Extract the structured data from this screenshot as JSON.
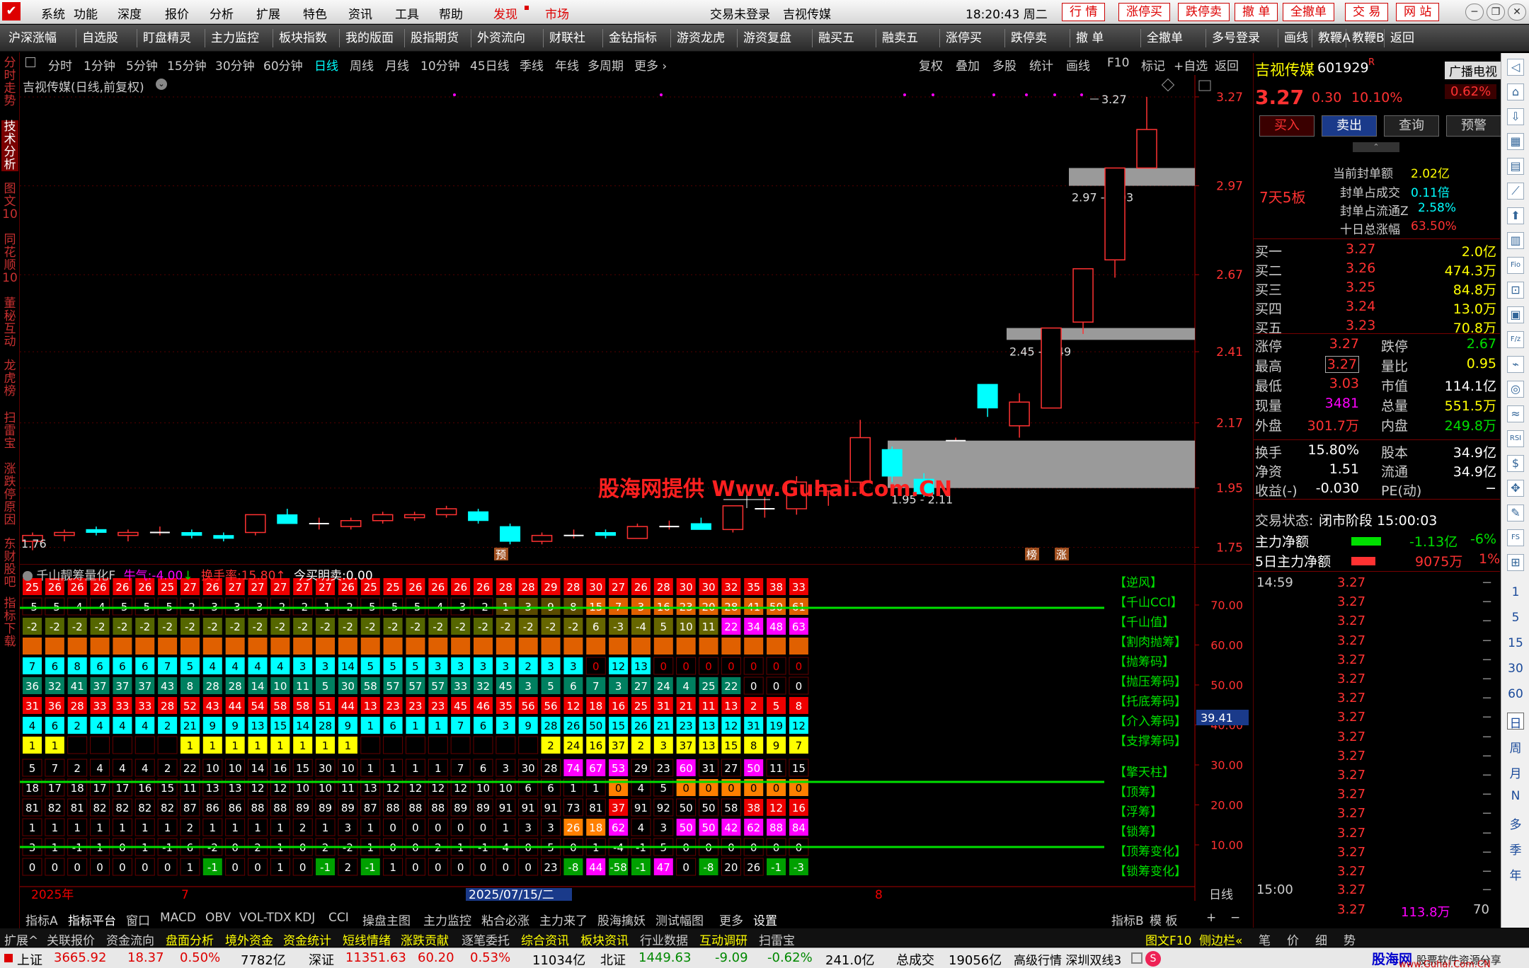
{
  "menu": {
    "items": [
      "系统",
      "功能",
      "深度",
      "报价",
      "分析",
      "扩展",
      "特色",
      "资讯",
      "工具",
      "帮助"
    ],
    "discover": "发现",
    "market": "市场",
    "login_status": "交易未登录",
    "window_stock": "吉视传媒",
    "clock": "18:20:43 周二",
    "quick": [
      "行 情",
      "涨停买",
      "跌停卖",
      "撤 单",
      "全撤单",
      "交 易",
      "网 站"
    ]
  },
  "toolbar": {
    "items": [
      "沪深涨幅",
      "自选股",
      "盯盘精灵",
      "主力监控",
      "板块指数",
      "我的版面",
      "股指期货",
      "外资流向",
      "财联社",
      "金钻指标",
      "游资龙虎",
      "游资复盘",
      "融买五",
      "融卖五",
      "涨停买",
      "跌停卖",
      "撤 单",
      "全撤单",
      "多号登录",
      "画线",
      "教鞭A",
      "教鞭B",
      "返回"
    ]
  },
  "leftnav": {
    "items": [
      "分时走势",
      "技术分析",
      "图文10",
      "同花顺10",
      "董秘互动",
      "龙虎榜",
      "扫雷宝",
      "涨跌停原因",
      "东财股吧",
      "指标下载"
    ]
  },
  "period": {
    "items": [
      "分时",
      "1分钟",
      "5分钟",
      "15分钟",
      "30分钟",
      "60分钟",
      "日线",
      "周线",
      "月线",
      "10分钟",
      "45日线",
      "季线",
      "年线",
      "多周期",
      "更多 ›"
    ],
    "active": "日线",
    "tools": [
      "复权",
      "叠加",
      "多股",
      "统计",
      "画线",
      "F10",
      "标记",
      "+自选",
      "返回"
    ]
  },
  "chart_title": "吉视传媒(日线,前复权)",
  "chart_data": {
    "type": "candlestick",
    "ylim": [
      1.72,
      3.32
    ],
    "yticks": [
      "3.27",
      "2.97",
      "2.67",
      "2.41",
      "2.17",
      "1.95",
      "1.75"
    ],
    "candles": [
      {
        "o": 1.77,
        "h": 1.8,
        "l": 1.74,
        "c": 1.79
      },
      {
        "o": 1.79,
        "h": 1.81,
        "l": 1.77,
        "c": 1.8
      },
      {
        "o": 1.81,
        "h": 1.82,
        "l": 1.79,
        "c": 1.8
      },
      {
        "o": 1.79,
        "h": 1.81,
        "l": 1.77,
        "c": 1.8
      },
      {
        "o": 1.8,
        "h": 1.82,
        "l": 1.79,
        "c": 1.8
      },
      {
        "o": 1.8,
        "h": 1.81,
        "l": 1.78,
        "c": 1.79
      },
      {
        "o": 1.79,
        "h": 1.8,
        "l": 1.77,
        "c": 1.78
      },
      {
        "o": 1.8,
        "h": 1.86,
        "l": 1.79,
        "c": 1.86
      },
      {
        "o": 1.86,
        "h": 1.88,
        "l": 1.83,
        "c": 1.83
      },
      {
        "o": 1.83,
        "h": 1.85,
        "l": 1.81,
        "c": 1.83
      },
      {
        "o": 1.82,
        "h": 1.85,
        "l": 1.81,
        "c": 1.84
      },
      {
        "o": 1.84,
        "h": 1.87,
        "l": 1.83,
        "c": 1.86
      },
      {
        "o": 1.85,
        "h": 1.87,
        "l": 1.84,
        "c": 1.86
      },
      {
        "o": 1.86,
        "h": 1.89,
        "l": 1.85,
        "c": 1.88
      },
      {
        "o": 1.87,
        "h": 1.88,
        "l": 1.83,
        "c": 1.84
      },
      {
        "o": 1.82,
        "h": 1.83,
        "l": 1.76,
        "c": 1.77
      },
      {
        "o": 1.77,
        "h": 1.8,
        "l": 1.76,
        "c": 1.79
      },
      {
        "o": 1.79,
        "h": 1.81,
        "l": 1.78,
        "c": 1.79
      },
      {
        "o": 1.8,
        "h": 1.81,
        "l": 1.78,
        "c": 1.79
      },
      {
        "o": 1.78,
        "h": 1.83,
        "l": 1.78,
        "c": 1.82
      },
      {
        "o": 1.82,
        "h": 1.84,
        "l": 1.81,
        "c": 1.82
      },
      {
        "o": 1.83,
        "h": 1.85,
        "l": 1.81,
        "c": 1.81
      },
      {
        "o": 1.81,
        "h": 1.89,
        "l": 1.8,
        "c": 1.89
      },
      {
        "o": 1.88,
        "h": 1.92,
        "l": 1.85,
        "c": 1.88
      },
      {
        "o": 1.88,
        "h": 1.99,
        "l": 1.86,
        "c": 1.97
      },
      {
        "o": 1.94,
        "h": 1.96,
        "l": 1.89,
        "c": 1.96
      },
      {
        "o": 1.97,
        "h": 2.18,
        "l": 1.93,
        "c": 2.12
      },
      {
        "o": 2.08,
        "h": 2.09,
        "l": 1.97,
        "c": 1.99
      },
      {
        "o": 1.98,
        "h": 2.0,
        "l": 1.92,
        "c": 1.93
      },
      {
        "o": 2.11,
        "h": 2.12,
        "l": 2.11,
        "c": 2.11
      },
      {
        "o": 2.3,
        "h": 2.3,
        "l": 2.19,
        "c": 2.22
      },
      {
        "o": 2.16,
        "h": 2.27,
        "l": 2.12,
        "c": 2.24
      },
      {
        "o": 2.22,
        "h": 2.49,
        "l": 2.22,
        "c": 2.49
      },
      {
        "o": 2.51,
        "h": 2.69,
        "l": 2.47,
        "c": 2.69
      },
      {
        "o": 2.72,
        "h": 3.03,
        "l": 2.66,
        "c": 3.03
      },
      {
        "o": 3.03,
        "h": 3.27,
        "l": 3.03,
        "c": 3.16
      }
    ],
    "zones": [
      {
        "label": "2.97 - 3.03",
        "low": 2.97,
        "high": 3.03
      },
      {
        "label": "2.45 - 2.49",
        "low": 2.45,
        "high": 2.49
      },
      {
        "label": "1.95 - 2.11",
        "low": 1.95,
        "high": 2.11
      }
    ],
    "annotations": {
      "high": "3.27",
      "low": "1.76",
      "yu": "预",
      "bang": "榜",
      "zhang": "涨",
      "watermark": "股海网提供 Www.Guhai.Com.CN"
    }
  },
  "indicator": {
    "name": "千山靓筹量化F",
    "niuqi_label": "牛气:",
    "niuqi_value": "-4.00",
    "huanshou_label": "换手率:",
    "huanshou_value": "15.80",
    "jin_label": "今买明卖:",
    "jin_value": "0.00",
    "yticks": [
      "70.00",
      "60.00",
      "50.00",
      "40.00",
      "30.00",
      "20.00",
      "10.00"
    ],
    "cursor_value": "39.41",
    "row_labels": [
      "【逆风】",
      "【千山CCI】",
      "【千山值】",
      "【割肉抛筹】",
      "【抛筹码】",
      "【抛压筹码】",
      "【托底筹码】",
      "【介入筹码】",
      "【支撑筹码】",
      "【擎天柱】",
      "【顶筹】",
      "【浮筹】",
      "【锁筹】",
      "【顶筹变化】",
      "【锁筹变化】"
    ],
    "grid": [
      [
        "25",
        "26",
        "26",
        "26",
        "26",
        "26",
        "25",
        "27",
        "26",
        "27",
        "27",
        "27",
        "27",
        "27",
        "26",
        "25",
        "25",
        "26",
        "26",
        "26",
        "26",
        "28",
        "28",
        "29",
        "28",
        "30",
        "27",
        "26",
        "28",
        "30",
        "30",
        "32",
        "35",
        "38",
        "33"
      ],
      [
        "-5",
        "-5",
        "-4",
        "-4",
        "-5",
        "-5",
        "-5",
        "-2",
        "-3",
        "-3",
        "-3",
        "-2",
        "-2",
        "-1",
        "-2",
        "-5",
        "-5",
        "-5",
        "-4",
        "-3",
        "-2",
        "1",
        "3",
        "9",
        "8",
        "15",
        "7",
        "3",
        "16",
        "23",
        "20",
        "28",
        "41",
        "50",
        "61"
      ],
      [
        "-2",
        "-2",
        "-2",
        "-2",
        "-2",
        "-2",
        "-2",
        "-2",
        "-2",
        "-2",
        "-2",
        "-2",
        "-2",
        "-2",
        "-2",
        "-2",
        "-2",
        "-2",
        "-2",
        "-2",
        "-2",
        "-2",
        "-2",
        "-2",
        "-2",
        "6",
        "-3",
        "-4",
        "5",
        "10",
        "11",
        "22",
        "34",
        "48",
        "63"
      ],
      [
        "",
        "",
        "",
        "",
        "",
        "",
        "",
        "",
        "",
        "",
        "",
        "",
        "",
        "",
        "",
        "",
        "",
        "",
        "",
        "",
        "",
        "",
        "",
        "",
        "",
        "0",
        "0",
        "0",
        "0",
        "0",
        "0",
        "0",
        "0",
        "0",
        "0"
      ],
      [
        "7",
        "6",
        "8",
        "6",
        "6",
        "6",
        "7",
        "5",
        "4",
        "4",
        "4",
        "4",
        "3",
        "3",
        "14",
        "5",
        "5",
        "5",
        "3",
        "3",
        "3",
        "3",
        "2",
        "3",
        "3",
        "0",
        "12",
        "13",
        "0",
        "0",
        "0",
        "0",
        "0",
        "0",
        "0"
      ],
      [
        "36",
        "32",
        "41",
        "37",
        "37",
        "37",
        "43",
        "8",
        "28",
        "28",
        "14",
        "10",
        "11",
        "5",
        "30",
        "58",
        "57",
        "57",
        "57",
        "33",
        "32",
        "45",
        "3",
        "5",
        "6",
        "7",
        "3",
        "27",
        "24",
        "4",
        "25",
        "22",
        "0",
        "0",
        "0"
      ],
      [
        "31",
        "36",
        "28",
        "33",
        "33",
        "33",
        "28",
        "52",
        "43",
        "44",
        "54",
        "58",
        "58",
        "51",
        "44",
        "13",
        "23",
        "23",
        "23",
        "45",
        "46",
        "35",
        "56",
        "56",
        "12",
        "18",
        "16",
        "25",
        "31",
        "21",
        "11",
        "13",
        "2",
        "5",
        "8"
      ],
      [
        "4",
        "6",
        "2",
        "4",
        "4",
        "4",
        "2",
        "21",
        "9",
        "9",
        "13",
        "15",
        "14",
        "28",
        "9",
        "1",
        "6",
        "1",
        "1",
        "7",
        "6",
        "3",
        "9",
        "28",
        "26",
        "50",
        "15",
        "26",
        "21",
        "23",
        "13",
        "12",
        "31",
        "19",
        "12"
      ],
      [
        "1",
        "1",
        "",
        "",
        "",
        "",
        "",
        "1",
        "1",
        "1",
        "1",
        "1",
        "1",
        "1",
        "1",
        "",
        "",
        "",
        "",
        "",
        "",
        "",
        "",
        "2",
        "24",
        "16",
        "37",
        "2",
        "3",
        "37",
        "13",
        "15",
        "8",
        "9",
        "7"
      ],
      [
        "5",
        "7",
        "2",
        "4",
        "4",
        "4",
        "2",
        "22",
        "10",
        "10",
        "14",
        "16",
        "15",
        "30",
        "10",
        "1",
        "1",
        "1",
        "1",
        "7",
        "6",
        "3",
        "30",
        "28",
        "74",
        "67",
        "53",
        "29",
        "23",
        "60",
        "31",
        "27",
        "50",
        "11",
        "15"
      ],
      [
        "18",
        "17",
        "18",
        "17",
        "17",
        "16",
        "15",
        "11",
        "13",
        "13",
        "12",
        "12",
        "10",
        "10",
        "11",
        "13",
        "12",
        "12",
        "12",
        "12",
        "10",
        "10",
        "6",
        "6",
        "1",
        "1",
        "0",
        "4",
        "5",
        "0",
        "0",
        "0",
        "0",
        "0",
        "0"
      ],
      [
        "81",
        "82",
        "81",
        "82",
        "82",
        "82",
        "82",
        "87",
        "86",
        "86",
        "88",
        "88",
        "89",
        "89",
        "89",
        "87",
        "88",
        "88",
        "88",
        "89",
        "89",
        "91",
        "91",
        "91",
        "73",
        "81",
        "37",
        "91",
        "92",
        "50",
        "50",
        "58",
        "38",
        "12",
        "16"
      ],
      [
        "1",
        "1",
        "1",
        "1",
        "1",
        "1",
        "1",
        "2",
        "1",
        "1",
        "1",
        "1",
        "2",
        "1",
        "3",
        "1",
        "0",
        "0",
        "0",
        "0",
        "0",
        "1",
        "3",
        "3",
        "26",
        "18",
        "62",
        "4",
        "3",
        "50",
        "50",
        "42",
        "62",
        "88",
        "84"
      ],
      [
        "3",
        "1",
        "-1",
        "1",
        "0",
        "1",
        "-1",
        "6",
        "-2",
        "0",
        "2",
        "1",
        "0",
        "2",
        "-2",
        "1",
        "0",
        "0",
        "2",
        "1",
        "-1",
        "4",
        "0",
        "5",
        "0",
        "1",
        "-4",
        "-1",
        "5",
        "0",
        "0",
        "0",
        "0",
        "0",
        "0"
      ],
      [
        "0",
        "0",
        "0",
        "0",
        "0",
        "0",
        "0",
        "1",
        "-1",
        "0",
        "0",
        "1",
        "0",
        "-1",
        "2",
        "-1",
        "1",
        "0",
        "0",
        "0",
        "0",
        "0",
        "0",
        "23",
        "-8",
        "44",
        "-58",
        "-1",
        "47",
        "0",
        "-8",
        "20",
        "26",
        "-1",
        "-3"
      ]
    ],
    "date_labels": [
      "2025年",
      "7",
      "2025/07/15/二",
      "8"
    ],
    "period_label": "日线"
  },
  "bottom_tabs": {
    "items": [
      "指标A",
      "指标平台",
      "窗口",
      "MACD",
      "OBV",
      "VOL-TDX",
      "KDJ",
      "CCI",
      "操盘主图",
      "主力监控",
      "粘合必涨",
      "主力来了",
      "股海擒妖",
      "测试幅图",
      "更多",
      "设置"
    ],
    "right": [
      "指标B",
      "模 板",
      "+",
      "−"
    ]
  },
  "bottom_tabs2": {
    "items": [
      "扩展^",
      "关联报价",
      "资金流向",
      "盘面分析",
      "境外资金",
      "资金统计",
      "短线情绪",
      "涨跌贡献",
      "逐笔委托",
      "综合资讯",
      "板块资讯",
      "行业数据",
      "互动调研",
      "扫雷宝"
    ],
    "right": [
      "图文F10",
      "侧边栏«",
      "笔",
      "价",
      "细",
      "势"
    ]
  },
  "status": {
    "sh_label": "上证",
    "sh_val": "3665.92",
    "sh_chg": "18.37",
    "sh_pct": "0.50%",
    "sh_amt": "7782亿",
    "sz_label": "深证",
    "sz_val": "11351.63",
    "sz_chg": "60.20",
    "sz_pct": "0.53%",
    "sz_amt": "11034亿",
    "bz_label": "北证",
    "bz_val": "1449.63",
    "bz_chg": "-9.09",
    "bz_pct": "-0.62%",
    "bz_amt": "241.0亿",
    "total_label": "总成交",
    "total_val": "19056亿",
    "mode": "高级行情 深圳双线3",
    "brand": "股海网",
    "brand_sub": "股票软件资源分享",
    "brand_url": "www.Guhai.Com.CN"
  },
  "quote": {
    "name": "吉视传媒",
    "code": "601929",
    "r": "R",
    "broadcast": "广播电视",
    "sector_pct": "0.62%",
    "price": "3.27",
    "change": "0.30",
    "pct": "10.10%",
    "buttons": [
      "买入",
      "卖出",
      "查询",
      "预警"
    ],
    "streak": "7天5板",
    "seal_label": "当前封单额",
    "seal_val": "2.02亿",
    "seal_turn_label": "封单占成交",
    "seal_turn_val": "0.11倍",
    "seal_float_label": "封单占流通Z",
    "seal_float_val": "2.58%",
    "ten_day_label": "十日总涨幅",
    "ten_day_val": "63.50%",
    "bids": [
      [
        "买一",
        "3.27",
        "2.0亿"
      ],
      [
        "买二",
        "3.26",
        "474.3万"
      ],
      [
        "买三",
        "3.25",
        "84.8万"
      ],
      [
        "买四",
        "3.24",
        "13.0万"
      ],
      [
        "买五",
        "3.23",
        "70.8万"
      ]
    ],
    "stats": [
      [
        "涨停",
        "3.27",
        "跌停",
        "2.67"
      ],
      [
        "最高",
        "3.27",
        "量比",
        "0.95"
      ],
      [
        "最低",
        "3.03",
        "市值",
        "114.1亿"
      ],
      [
        "现量",
        "3481",
        "总量",
        "551.5万"
      ],
      [
        "外盘",
        "301.7万",
        "内盘",
        "249.8万"
      ]
    ],
    "stats2": [
      [
        "换手",
        "15.80%",
        "股本",
        "34.9亿"
      ],
      [
        "净资",
        "1.51",
        "流通",
        "34.9亿"
      ],
      [
        "收益(-)",
        "-0.030",
        "PE(动)",
        "−"
      ]
    ],
    "trade_status_label": "交易状态:",
    "trade_status_val": "闭市阶段 15:00:03",
    "main_net_label": "主力净额",
    "main_net_val": "-1.13亿",
    "main_net_pct": "-6%",
    "main5_label": "5日主力净额",
    "main5_val": "9075万",
    "main5_pct": "1%",
    "ticks_time1": "14:59",
    "ticks_time2": "15:00",
    "tick_price": "3.27",
    "tick_dash": "−",
    "last_vol": "113.8万",
    "last_num": "70"
  },
  "rightbar": {
    "labels": [
      "1",
      "5",
      "15",
      "30",
      "60",
      "日",
      "周",
      "月",
      "N",
      "多",
      "季",
      "年"
    ]
  }
}
